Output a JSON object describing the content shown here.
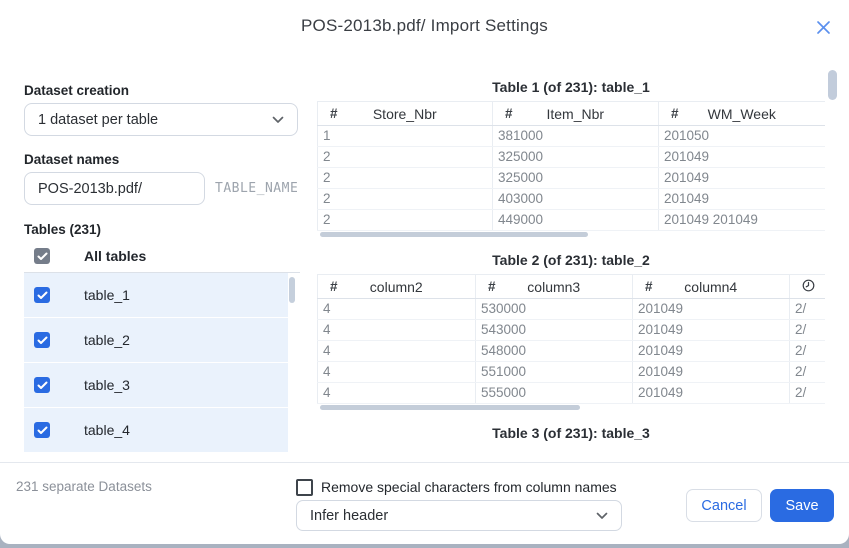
{
  "dialog": {
    "title": "POS-2013b.pdf/ Import Settings"
  },
  "left_panel": {
    "dataset_creation_label": "Dataset creation",
    "dataset_creation_value": "1 dataset per table",
    "dataset_names_label": "Dataset names",
    "dataset_name_value": "POS-2013b.pdf/",
    "dataset_name_suffix": "TABLE_NAME",
    "tables_header": "Tables (231)",
    "all_tables_label": "All tables",
    "all_tables_checked": true,
    "tables": [
      {
        "label": "table_1",
        "checked": true
      },
      {
        "label": "table_2",
        "checked": true
      },
      {
        "label": "table_3",
        "checked": true
      },
      {
        "label": "table_4",
        "checked": true
      }
    ]
  },
  "preview": {
    "tables": [
      {
        "title": "Table 1 (of 231): table_1",
        "columns": [
          {
            "type": "numeric",
            "icon": "#",
            "name": "Store_Nbr"
          },
          {
            "type": "numeric",
            "icon": "#",
            "name": "Item_Nbr"
          },
          {
            "type": "numeric",
            "icon": "#",
            "name": "WM_Week"
          }
        ],
        "rows": [
          [
            "1",
            "381000",
            "201050"
          ],
          [
            "2",
            "325000",
            "201049"
          ],
          [
            "2",
            "325000",
            "201049"
          ],
          [
            "2",
            "403000",
            "201049"
          ],
          [
            "2",
            "449000",
            "201049 201049"
          ]
        ]
      },
      {
        "title": "Table 2 (of 231): table_2",
        "columns": [
          {
            "type": "numeric",
            "icon": "#",
            "name": "column2"
          },
          {
            "type": "numeric",
            "icon": "#",
            "name": "column3"
          },
          {
            "type": "numeric",
            "icon": "#",
            "name": "column4"
          },
          {
            "type": "datetime",
            "icon": "clock",
            "name": ""
          }
        ],
        "rows": [
          [
            "4",
            "530000",
            "201049",
            "2/"
          ],
          [
            "4",
            "543000",
            "201049",
            "2/"
          ],
          [
            "4",
            "548000",
            "201049",
            "2/"
          ],
          [
            "4",
            "551000",
            "201049",
            "2/"
          ],
          [
            "4",
            "555000",
            "201049",
            "2/"
          ]
        ]
      },
      {
        "title": "Table 3 (of 231): table_3"
      }
    ]
  },
  "footer": {
    "summary": "231 separate Datasets",
    "remove_special_label": "Remove special characters from column names",
    "remove_special_checked": false,
    "header_mode_value": "Infer header",
    "cancel_label": "Cancel",
    "save_label": "Save"
  },
  "colors": {
    "accent": "#2a6be2",
    "checkbox_blue": "#2a6be2",
    "checkbox_gray": "#757d8a",
    "row_highlight": "#eaf2fc",
    "save_button": "#2a6be2"
  }
}
